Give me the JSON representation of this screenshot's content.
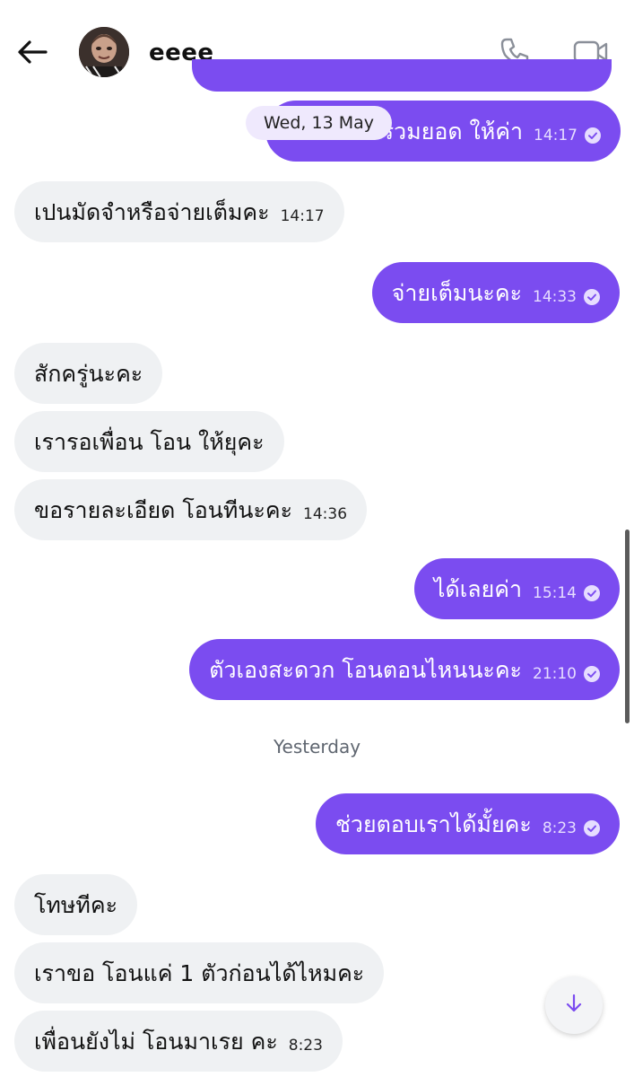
{
  "header": {
    "contact_name": "eeee_",
    "back_icon": "arrow-left-icon",
    "call_icon": "phone-icon",
    "video_icon": "video-camera-icon"
  },
  "chat": {
    "date_chip": "Wed, 13 May",
    "yesterday_label": "Yesterday",
    "messages": [
      {
        "direction": "out",
        "text": "รวมยอด ให้ค่า",
        "time": "14:17",
        "status": "read"
      },
      {
        "direction": "in",
        "text": "เปนมัดจำหรือจ่ายเต็มคะ",
        "time": "14:17"
      },
      {
        "direction": "out",
        "text": "จ่ายเต็มนะคะ",
        "time": "14:33",
        "status": "read"
      },
      {
        "direction": "in",
        "text": "สักครู่นะคะ",
        "time": ""
      },
      {
        "direction": "in",
        "text": "เรารอเพื่อน โอน ให้ยุคะ",
        "time": ""
      },
      {
        "direction": "in",
        "text": "ขอรายละเอียด โอนทีนะคะ",
        "time": "14:36"
      },
      {
        "direction": "out",
        "text": "ได้เลยค่า",
        "time": "15:14",
        "status": "read"
      },
      {
        "direction": "out",
        "text": "ตัวเองสะดวก โอนตอนไหนนะคะ",
        "time": "21:10",
        "status": "read"
      },
      {
        "direction": "out",
        "text": "ช่วยตอบเราได้มั้ยคะ",
        "time": "8:23",
        "status": "read"
      },
      {
        "direction": "in",
        "text": "โทษทีคะ",
        "time": ""
      },
      {
        "direction": "in",
        "text": "เราขอ โอนแค่ 1 ตัวก่อนได้ไหมคะ",
        "time": ""
      },
      {
        "direction": "in",
        "text": "เพื่อนยังไม่ โอนมาเรย คะ",
        "time": "8:23"
      }
    ]
  },
  "controls": {
    "scroll_down_icon": "arrow-down-icon"
  },
  "colors": {
    "outgoing_bubble": "#7b4cf0",
    "incoming_bubble": "#eff1f3",
    "date_chip_bg": "#efe9fd",
    "accent": "#7b4cf0"
  }
}
